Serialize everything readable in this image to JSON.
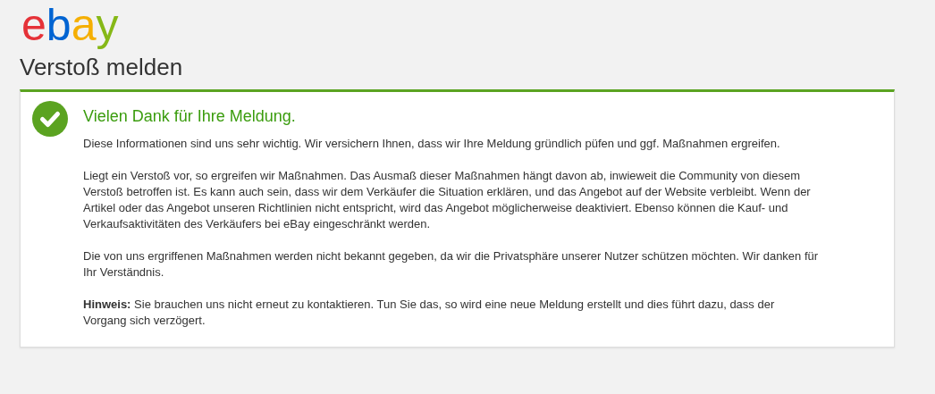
{
  "logo": "ebay",
  "page_title": "Verstoß melden",
  "message": {
    "kind": "success",
    "title": "Vielen Dank für Ihre Meldung.",
    "paragraphs": [
      {
        "lines": [
          "Diese Informationen sind uns sehr wichtig. Wir versichern Ihnen, dass wir Ihre Meldung gründlich püfen und ggf. Maßnahmen ergreifen."
        ]
      },
      {
        "lines": [
          "Liegt ein Verstoß vor, so ergreifen wir Maßnahmen. Das Ausmaß dieser Maßnahmen hängt davon ab, inwieweit die Community von diesem",
          "Verstoß betroffen ist. Es kann auch sein, dass wir dem Verkäufer die Situation erklären, und das Angebot auf der Website verbleibt. Wenn der",
          "Artikel oder das Angebot unseren Richtlinien nicht entspricht, wird das Angebot möglicherweise deaktiviert. Ebenso können die Kauf- und",
          "Verkaufsaktivitäten des Verkäufers bei eBay eingeschränkt werden."
        ]
      },
      {
        "lines": [
          "Die von uns ergriffenen Maßnahmen werden nicht bekannt gegeben, da wir die Privatsphäre unserer Nutzer schützen möchten. Wir danken für",
          "Ihr Verständnis."
        ]
      },
      {
        "lines": [
          "**Hinweis:** Sie brauchen uns nicht erneut zu kontaktieren. Tun Sie das, so wird eine neue Meldung erstellt und dies führt dazu, dass der",
          "Vorgang sich verzögert."
        ]
      }
    ]
  }
}
